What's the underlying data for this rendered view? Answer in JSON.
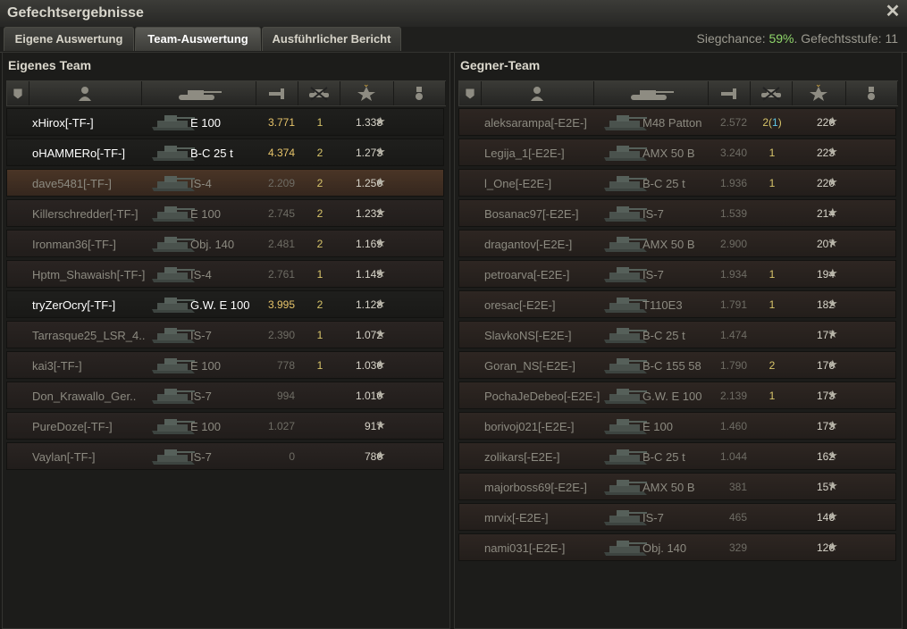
{
  "window": {
    "title": "Gefechtsergebnisse"
  },
  "tabs": [
    "Eigene Auswertung",
    "Team-Auswertung",
    "Ausführlicher Bericht"
  ],
  "active_tab": 1,
  "battle_info": {
    "win_chance_label": "Siegchance:",
    "win_chance_value": "59%",
    "tier_label": ". Gefechtsstufe: 11"
  },
  "own_team": {
    "title": "Eigenes Team",
    "players": [
      {
        "name": "xHirox[-TF-]",
        "tank": "E 100",
        "damage": "3.771",
        "kills": "1",
        "xp": "1.338",
        "alive": true
      },
      {
        "name": "oHAMMERo[-TF-]",
        "tank": "B-C 25 t",
        "damage": "4.374",
        "kills": "2",
        "xp": "1.273",
        "alive": true
      },
      {
        "name": "dave5481[-TF-]",
        "tank": "IS-4",
        "damage": "2.209",
        "kills": "2",
        "xp": "1.256",
        "alive": false,
        "highlight": true
      },
      {
        "name": "Killerschredder[-TF-]",
        "tank": "E 100",
        "damage": "2.745",
        "kills": "2",
        "xp": "1.232",
        "alive": false
      },
      {
        "name": "Ironman36[-TF-]",
        "tank": "Obj. 140",
        "damage": "2.481",
        "kills": "2",
        "xp": "1.169",
        "alive": false
      },
      {
        "name": "Hptm_Shawaish[-TF-]",
        "tank": "IS-4",
        "damage": "2.761",
        "kills": "1",
        "xp": "1.145",
        "alive": false
      },
      {
        "name": "tryZerOcry[-TF-]",
        "tank": "G.W. E 100",
        "damage": "3.995",
        "kills": "2",
        "xp": "1.128",
        "alive": true
      },
      {
        "name": "Tarrasque25_LSR_4..",
        "tank": "IS-7",
        "damage": "2.390",
        "kills": "1",
        "xp": "1.072",
        "alive": false
      },
      {
        "name": "kai3[-TF-]",
        "tank": "E 100",
        "damage": "778",
        "kills": "1",
        "xp": "1.036",
        "alive": false
      },
      {
        "name": "Don_Krawallo_Ger..",
        "tank": "IS-7",
        "damage": "994",
        "kills": "",
        "xp": "1.010",
        "alive": false
      },
      {
        "name": "PureDoze[-TF-]",
        "tank": "E 100",
        "damage": "1.027",
        "kills": "",
        "xp": "917",
        "alive": false
      },
      {
        "name": "Vaylan[-TF-]",
        "tank": "IS-7",
        "damage": "0",
        "kills": "",
        "xp": "786",
        "alive": false
      }
    ]
  },
  "enemy_team": {
    "title": "Gegner-Team",
    "players": [
      {
        "name": "aleksarampa[-E2E-]",
        "tank": "M48 Patton",
        "damage": "2.572",
        "kills": "2",
        "assist": "1",
        "xp": "226"
      },
      {
        "name": "Legija_1[-E2E-]",
        "tank": "AMX 50 B",
        "damage": "3.240",
        "kills": "1",
        "xp": "223"
      },
      {
        "name": "l_One[-E2E-]",
        "tank": "B-C 25 t",
        "damage": "1.936",
        "kills": "1",
        "xp": "220"
      },
      {
        "name": "Bosanac97[-E2E-]",
        "tank": "IS-7",
        "damage": "1.539",
        "kills": "",
        "xp": "214"
      },
      {
        "name": "dragantov[-E2E-]",
        "tank": "AMX 50 B",
        "damage": "2.900",
        "kills": "",
        "xp": "207"
      },
      {
        "name": "petroarva[-E2E-]",
        "tank": "IS-7",
        "damage": "1.934",
        "kills": "1",
        "xp": "194"
      },
      {
        "name": "oresac[-E2E-]",
        "tank": "T110E3",
        "damage": "1.791",
        "kills": "1",
        "xp": "182"
      },
      {
        "name": "SlavkoNS[-E2E-]",
        "tank": "B-C 25 t",
        "damage": "1.474",
        "kills": "",
        "xp": "177"
      },
      {
        "name": "Goran_NS[-E2E-]",
        "tank": "B-C 155 58",
        "damage": "1.790",
        "kills": "2",
        "xp": "176"
      },
      {
        "name": "PochaJeDebeo[-E2E-]",
        "tank": "G.W. E 100",
        "damage": "2.139",
        "kills": "1",
        "xp": "173"
      },
      {
        "name": "borivoj021[-E2E-]",
        "tank": "E 100",
        "damage": "1.460",
        "kills": "",
        "xp": "173"
      },
      {
        "name": "zolikars[-E2E-]",
        "tank": "B-C 25 t",
        "damage": "1.044",
        "kills": "",
        "xp": "162"
      },
      {
        "name": "majorboss69[-E2E-]",
        "tank": "AMX 50 B",
        "damage": "381",
        "kills": "",
        "xp": "157"
      },
      {
        "name": "mrvix[-E2E-]",
        "tank": "IS-7",
        "damage": "465",
        "kills": "",
        "xp": "146"
      },
      {
        "name": "nami031[-E2E-]",
        "tank": "Obj. 140",
        "damage": "329",
        "kills": "",
        "xp": "126"
      }
    ]
  },
  "columns": [
    "squad-icon",
    "player-icon",
    "tank-icon",
    "damage-icon",
    "kills-icon",
    "star-icon",
    "medal-icon"
  ],
  "colors": {
    "win_chance": "#8fd66a",
    "damage_alive": "#e7c46a",
    "assist": "#5fc8e8"
  }
}
